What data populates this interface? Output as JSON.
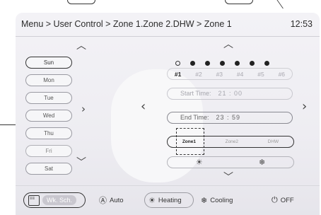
{
  "header": {
    "breadcrumb": "Menu > User Control > Zone 1.Zone 2.DHW > Zone 1",
    "time": "12:53"
  },
  "days": [
    {
      "label": "Sun",
      "state": "active"
    },
    {
      "label": "Mon",
      "state": "normal"
    },
    {
      "label": "Tue",
      "state": "normal"
    },
    {
      "label": "Wed",
      "state": "normal"
    },
    {
      "label": "Thu",
      "state": "normal"
    },
    {
      "label": "Fri",
      "state": "dim"
    },
    {
      "label": "Sat",
      "state": "normal"
    }
  ],
  "periods": [
    "#1",
    "#2",
    "#3",
    "#4",
    "#5",
    "#6"
  ],
  "start_time": {
    "label": "Start Time:",
    "value": "21 : 00"
  },
  "end_time": {
    "label": "End Time:",
    "value": "23 : 59"
  },
  "zones": [
    "Zone1",
    "Zone2",
    "DHW"
  ],
  "modes": {
    "heat_icon": "sun-icon",
    "cool_icon": "snowflake-icon"
  },
  "bottom": {
    "schedule_label": "Wk. Sch.",
    "auto_label": "Auto",
    "heating_label": "Heating",
    "cooling_label": "Cooling",
    "off_label": "OFF"
  },
  "colors": {
    "accent": "#333333",
    "inactive": "#a9a9b0"
  }
}
